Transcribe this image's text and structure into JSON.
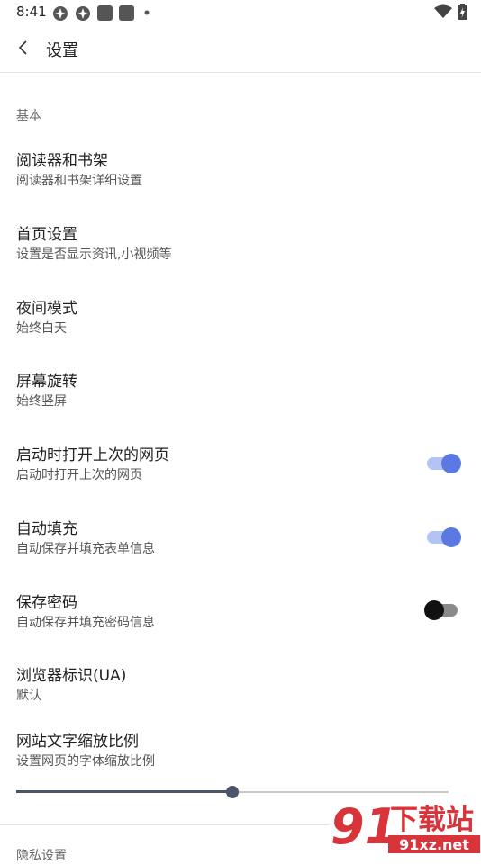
{
  "status_bar": {
    "time": "8:41"
  },
  "app_bar": {
    "title": "设置"
  },
  "section_basic": {
    "label": "基本"
  },
  "rows": [
    {
      "title": "阅读器和书架",
      "subtitle": "阅读器和书架详细设置"
    },
    {
      "title": "首页设置",
      "subtitle": "设置是否显示资讯,小视频等"
    },
    {
      "title": "夜间模式",
      "subtitle": "始终白天"
    },
    {
      "title": "屏幕旋转",
      "subtitle": "始终竖屏"
    },
    {
      "title": "启动时打开上次的网页",
      "subtitle": "启动时打开上次的网页",
      "switch_on": true
    },
    {
      "title": "自动填充",
      "subtitle": "自动保存并填充表单信息",
      "switch_on": true
    },
    {
      "title": "保存密码",
      "subtitle": "自动保存并填充密码信息",
      "switch_on": false
    },
    {
      "title": "浏览器标识(UA)",
      "subtitle": "默认"
    },
    {
      "title": "网站文字缩放比例",
      "subtitle": "设置网页的字体缩放比例"
    }
  ],
  "text_scale_slider": {
    "fraction": 0.5
  },
  "next_section": {
    "label": "隐私设置"
  },
  "watermark": {
    "brand": "下载站",
    "domain": "91xz.net",
    "logo": "91"
  },
  "colors": {
    "accent": "#5b79e1",
    "accent_track": "#b3c3f3",
    "slider": "#4a5568"
  }
}
